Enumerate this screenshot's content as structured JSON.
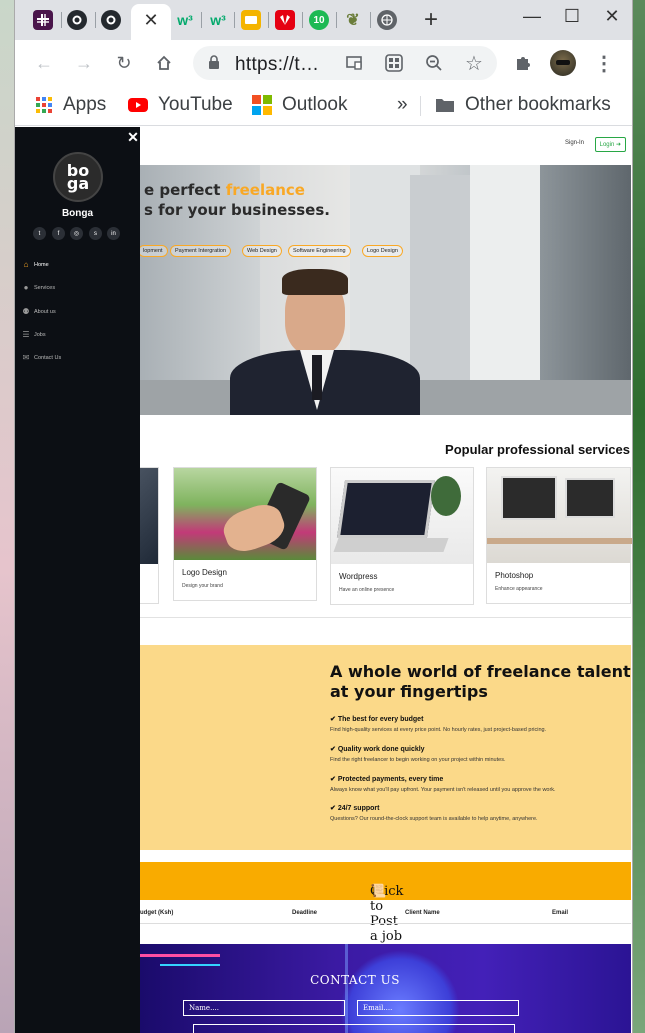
{
  "browser": {
    "tabs": [
      {
        "icon": "slack-icon"
      },
      {
        "icon": "github-icon"
      },
      {
        "icon": "github-icon"
      },
      {
        "icon": "close-icon",
        "active": true
      },
      {
        "icon": "w3schools-icon"
      },
      {
        "icon": "w3schools-icon"
      },
      {
        "icon": "slides-icon"
      },
      {
        "icon": "huawei-icon"
      },
      {
        "icon": "ten-icon",
        "label": "10"
      },
      {
        "icon": "tree-icon"
      },
      {
        "icon": "globe-icon"
      }
    ],
    "new_tab": "+",
    "url": "https://t…",
    "bookmarks": {
      "apps": "Apps",
      "youtube": "YouTube",
      "outlook": "Outlook",
      "more": "»",
      "other": "Other bookmarks"
    }
  },
  "site": {
    "header": {
      "signin": "Sign-In",
      "login": "Login"
    },
    "sidebar": {
      "brand": "Bonga",
      "logo_text": "bo\nga",
      "social": [
        "twitter-icon",
        "facebook-icon",
        "instagram-icon",
        "skype-icon",
        "linkedin-icon"
      ],
      "nav": [
        {
          "label": "Home",
          "icon": "home-icon"
        },
        {
          "label": "Services",
          "icon": "user-icon"
        },
        {
          "label": "About us",
          "icon": "users-icon"
        },
        {
          "label": "Jobs",
          "icon": "list-icon"
        },
        {
          "label": "Contact Us",
          "icon": "envelope-icon"
        }
      ]
    },
    "hero": {
      "line1_prefix": "e perfect ",
      "line1_highlight": "freelance",
      "line2": "s for your businesses.",
      "pills": [
        "lopment",
        "Payment Intergration",
        "Web Design",
        "Software Engineering",
        "Logo Design"
      ]
    },
    "popular": {
      "title": "Popular professional services",
      "cards": [
        {
          "title": "",
          "subtitle": ""
        },
        {
          "title": "Logo Design",
          "subtitle": "Design your brand"
        },
        {
          "title": "Wordpress",
          "subtitle": "Have an online presence"
        },
        {
          "title": "Photoshop",
          "subtitle": "Enhance appearance"
        }
      ]
    },
    "talent": {
      "title_line1": "A whole world of freelance talent",
      "title_line2": "at your fingertips",
      "features": [
        {
          "title": "The best for every budget",
          "desc": "Find high-quality services at every price point. No hourly rates, just project-based pricing."
        },
        {
          "title": "Quality work done quickly",
          "desc": "Find the right freelancer to begin working on your project within minutes."
        },
        {
          "title": "Protected payments, every time",
          "desc": "Always know what you'll pay upfront. Your payment isn't released until you approve the work."
        },
        {
          "title": "24/7 support",
          "desc": "Questions? Our round-the-clock support team is available to help anytime, anywhere."
        }
      ]
    },
    "post_job": "Click to Post a job",
    "table_headers": [
      "udget (Ksh)",
      "Deadline",
      "Client Name",
      "Email"
    ],
    "contact": {
      "title": "CONTACT US",
      "name_placeholder": "Name....",
      "email_placeholder": "Email...."
    }
  },
  "colors": {
    "accent": "#f9a825",
    "login_green": "#28a745",
    "talent_bg": "#fbd989",
    "postjob_bg": "#f9ab00",
    "sidebar_bg": "#0c0f14"
  }
}
